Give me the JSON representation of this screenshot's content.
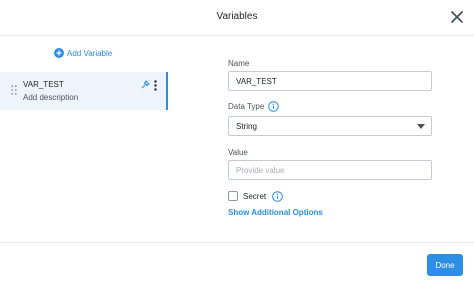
{
  "dialog": {
    "title": "Variables"
  },
  "sidebar": {
    "add_variable_label": "Add Variable",
    "items": [
      {
        "name": "VAR_TEST",
        "description": "Add description"
      }
    ]
  },
  "form": {
    "name_label": "Name",
    "name_value": "VAR_TEST",
    "data_type_label": "Data Type",
    "data_type_value": "String",
    "value_label": "Value",
    "value_placeholder": "Provide value",
    "secret_label": "Secret",
    "secret_checked": false,
    "show_options_label": "Show Additional Options"
  },
  "footer": {
    "done_label": "Done"
  },
  "colors": {
    "accent": "#2d8ee6",
    "selected_bg": "#eef4fb",
    "border": "#c5cbd3"
  }
}
